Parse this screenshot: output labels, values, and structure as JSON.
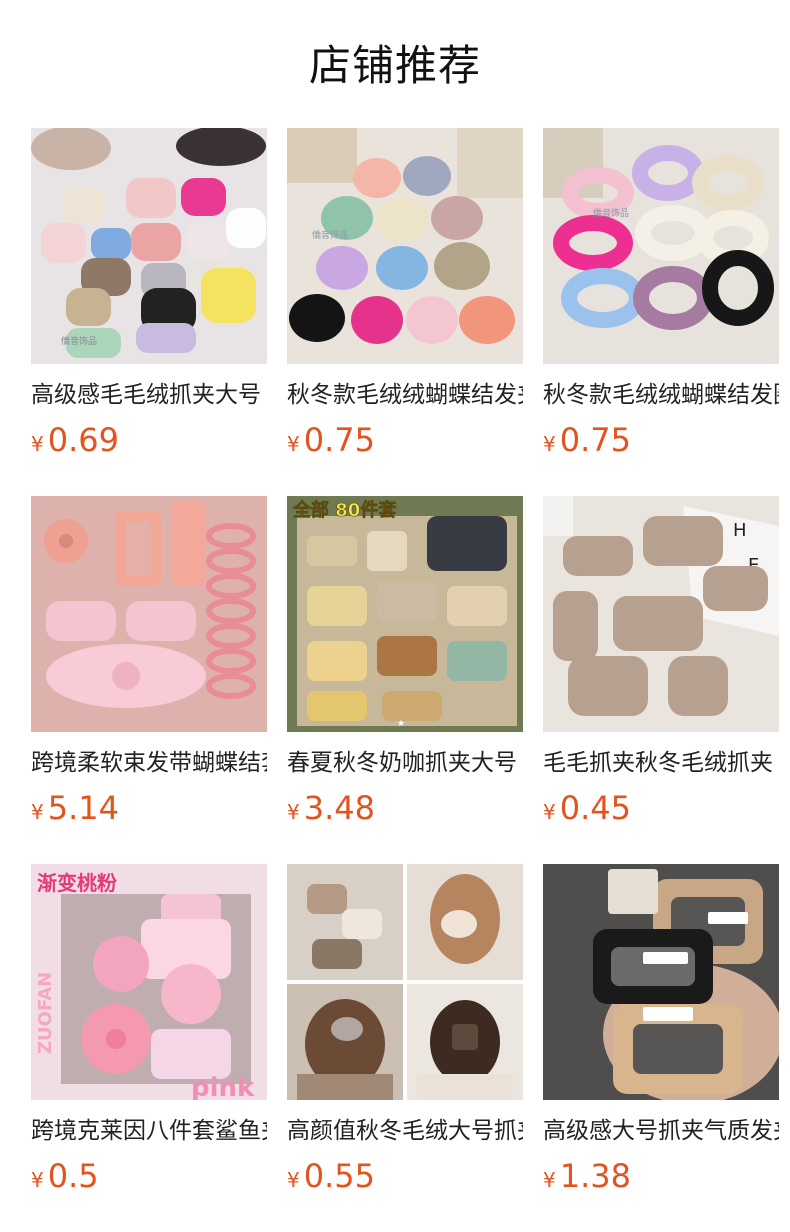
{
  "header": {
    "title": "店铺推荐"
  },
  "currency_symbol": "¥",
  "colors": {
    "price": "#e4531c",
    "title": "#111111"
  },
  "products": [
    {
      "name": "高级感毛毛绒抓夹大号",
      "price": "0.69",
      "image": "fluffy-claw-clips-assorted"
    },
    {
      "name": "秋冬款毛绒绒蝴蝶结发夹",
      "price": "0.75",
      "image": "fluffy-butterfly-clips"
    },
    {
      "name": "秋冬款毛绒绒蝴蝶结发圈",
      "price": "0.75",
      "image": "fluffy-scrunchies"
    },
    {
      "name": "跨境柔软束发带蝴蝶结套装",
      "price": "5.14",
      "image": "pink-hair-accessory-set"
    },
    {
      "name": "春夏秋冬奶咖抓夹大号",
      "price": "3.48",
      "image": "claw-clip-set-80pcs",
      "overlay": "全部 80件套"
    },
    {
      "name": "毛毛抓夹秋冬毛绒抓夹",
      "price": "0.45",
      "image": "beige-fluffy-claw-clips"
    },
    {
      "name": "跨境克莱因八件套鲨鱼夹",
      "price": "0.5",
      "image": "pink-gradient-clip-set",
      "overlay_top": "渐变桃粉",
      "overlay_side": "ZUOFAN",
      "overlay_bottom": "pink"
    },
    {
      "name": "高颜值秋冬毛绒大号抓夹",
      "price": "0.55",
      "image": "hair-clip-model-collage"
    },
    {
      "name": "高级感大号抓夹气质发夹",
      "price": "1.38",
      "image": "large-rectangle-claw-clips"
    }
  ]
}
